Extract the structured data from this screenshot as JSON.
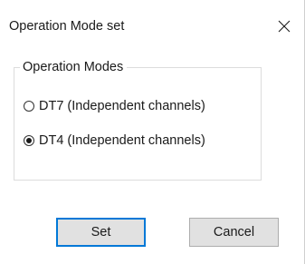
{
  "dialog": {
    "title": "Operation Mode set",
    "close_icon": "close-icon"
  },
  "group": {
    "legend": "Operation Modes",
    "options": [
      {
        "label": "DT7 (Independent channels)",
        "checked": false
      },
      {
        "label": "DT4 (Independent channels)",
        "checked": true
      }
    ]
  },
  "buttons": {
    "set_label": "Set",
    "cancel_label": "Cancel"
  },
  "colors": {
    "accent": "#0078d7",
    "button_bg": "#e1e1e1"
  }
}
